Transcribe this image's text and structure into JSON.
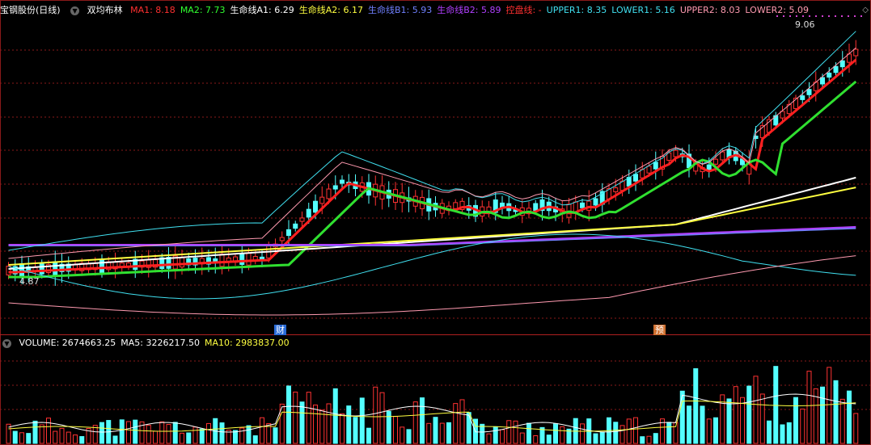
{
  "header": {
    "stock_name": "宝钢股份(日线)",
    "indicator_name": "双均布林",
    "items": [
      {
        "label": "MA1: 8.18",
        "color": "#ff3030"
      },
      {
        "label": "MA2: 7.73",
        "color": "#30ff30"
      },
      {
        "label": "生命线A1: 6.29",
        "color": "#ffffff"
      },
      {
        "label": "生命线A2: 6.17",
        "color": "#ffff40"
      },
      {
        "label": "生命线B1: 5.93",
        "color": "#7080ff"
      },
      {
        "label": "生命线B2: 5.89",
        "color": "#b040ff"
      },
      {
        "label": "控盘线: -",
        "color": "#ff3030"
      },
      {
        "label": "UPPER1: 8.35",
        "color": "#40e0f0"
      },
      {
        "label": "LOWER1: 5.16",
        "color": "#40e0f0"
      },
      {
        "label": "UPPER2: 8.03",
        "color": "#ff9ab0"
      },
      {
        "label": "LOWER2: 5.09",
        "color": "#ff9ab0"
      }
    ]
  },
  "volume_header": {
    "items": [
      {
        "label": "VOLUME: 2674663.25",
        "color": "#ffffff"
      },
      {
        "label": "MA5: 3226217.50",
        "color": "#ffffff"
      },
      {
        "label": "MA10: 2983837.00",
        "color": "#ffff40"
      }
    ]
  },
  "price_labels": {
    "high": "9.06",
    "low": "4.87"
  },
  "markers": {
    "cai": "财",
    "yu": "预"
  },
  "colors": {
    "up": "#ff3232",
    "down": "#54ffff",
    "ma1": "#ff2020",
    "ma2": "#30e030",
    "a1": "#ffffff",
    "a2": "#ffff40",
    "b1": "#7080ff",
    "b2": "#b040ff",
    "boll1": "#40e0f0",
    "boll2": "#ff9ab0",
    "grid": "#8a1a1a"
  }
}
